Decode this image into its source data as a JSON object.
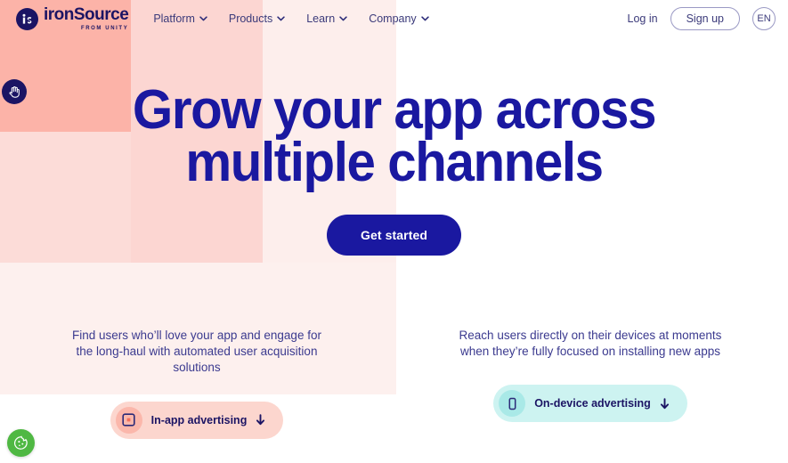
{
  "brand": {
    "logo_text": "ironSource",
    "logo_sub": "FROM UNITY",
    "logo_mark_icon": "is-monogram-icon",
    "navy": "#1b1464",
    "blue": "#1a18a0"
  },
  "header": {
    "nav_items": [
      {
        "label": "Platform",
        "icon": "chevron-down-icon"
      },
      {
        "label": "Products",
        "icon": "chevron-down-icon"
      },
      {
        "label": "Learn",
        "icon": "chevron-down-icon"
      },
      {
        "label": "Company",
        "icon": "chevron-down-icon"
      }
    ],
    "login_label": "Log in",
    "signup_label": "Sign up",
    "language_label": "EN"
  },
  "hero": {
    "headline_line1": "Grow your app across",
    "headline_line2": "multiple channels",
    "cta_label": "Get started"
  },
  "columns": [
    {
      "description": "Find users who’ll love your app and engage for the long-haul with automated user acquisition solutions",
      "pill_label": "In-app advertising",
      "pill_icon": "square-ad-icon",
      "pill_arrow_icon": "arrow-down-icon",
      "pill_bg": "#fcd6ce",
      "pill_circle_bg": "#fbb7ab"
    },
    {
      "description": "Reach users directly on their devices at moments when they’re fully focused on installing new apps",
      "pill_label": "On-device advertising",
      "pill_icon": "mobile-phone-icon",
      "pill_arrow_icon": "arrow-down-icon",
      "pill_bg": "#cdf3f1",
      "pill_circle_bg": "#a9e9e7"
    }
  ],
  "widgets": {
    "cursor_badge_icon": "hand-pointer-icon",
    "cookie_badge_icon": "cookie-icon",
    "cookie_badge_color": "#4fb843"
  }
}
